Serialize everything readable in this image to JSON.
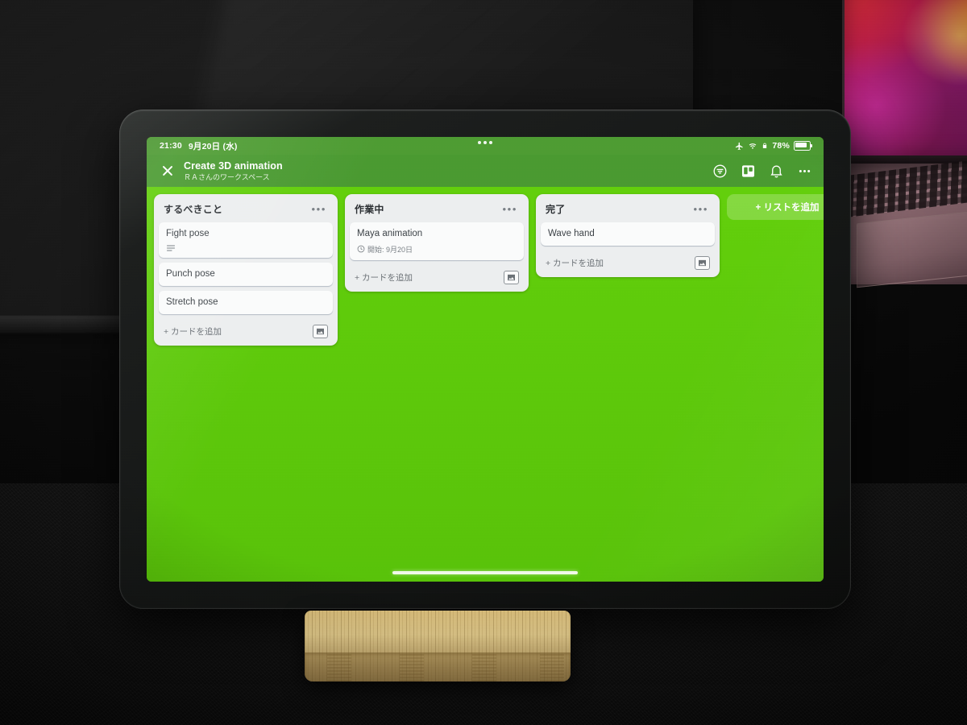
{
  "device": {
    "statusbar": {
      "time": "21:30",
      "date": "9月20日 (水)",
      "airplane_icon": "airplane-icon",
      "wifi_icon": "wifi-icon",
      "lock_icon": "lock-icon",
      "battery_percent": "78%",
      "battery_icon": "battery-icon"
    },
    "multitask_handle": "multitasking-handle",
    "home_indicator": "home-indicator"
  },
  "app": {
    "header": {
      "close_label": "close-icon",
      "board_title": "Create 3D animation",
      "workspace": "ＲＡさんのワークスペース",
      "actions": [
        {
          "name": "filter-icon",
          "label": "filter"
        },
        {
          "name": "board-icon",
          "label": "board"
        },
        {
          "name": "bell-icon",
          "label": "notifications"
        },
        {
          "name": "more-icon",
          "label": "more"
        }
      ]
    },
    "board": {
      "add_list_label": "+ リストを追加",
      "list_menu_glyph": "•••",
      "lists": [
        {
          "title": "するべきこと",
          "add_card_label": "+ カードを追加",
          "attach_icon": "image-attachment-icon",
          "cards": [
            {
              "title": "Fight pose",
              "has_description": true,
              "description_icon": "description-icon"
            },
            {
              "title": "Punch pose",
              "has_description": false
            },
            {
              "title": "Stretch pose",
              "has_description": false
            }
          ]
        },
        {
          "title": "作業中",
          "add_card_label": "+ カードを追加",
          "attach_icon": "image-attachment-icon",
          "cards": [
            {
              "title": "Maya animation",
              "has_due": true,
              "due_icon": "clock-icon",
              "due_label": "開始: 9月20日"
            }
          ]
        },
        {
          "title": "完了",
          "add_card_label": "+ カードを追加",
          "attach_icon": "image-attachment-icon",
          "cards": [
            {
              "title": "Wave hand"
            }
          ]
        }
      ]
    }
  },
  "colors": {
    "board_green": "#5fcc0a",
    "header_green": "#4a9a30",
    "statusbar_green": "#4e9c32",
    "list_bg": "#edeff0",
    "card_bg": "#fbfcfc",
    "text_dark": "#3c4247"
  }
}
